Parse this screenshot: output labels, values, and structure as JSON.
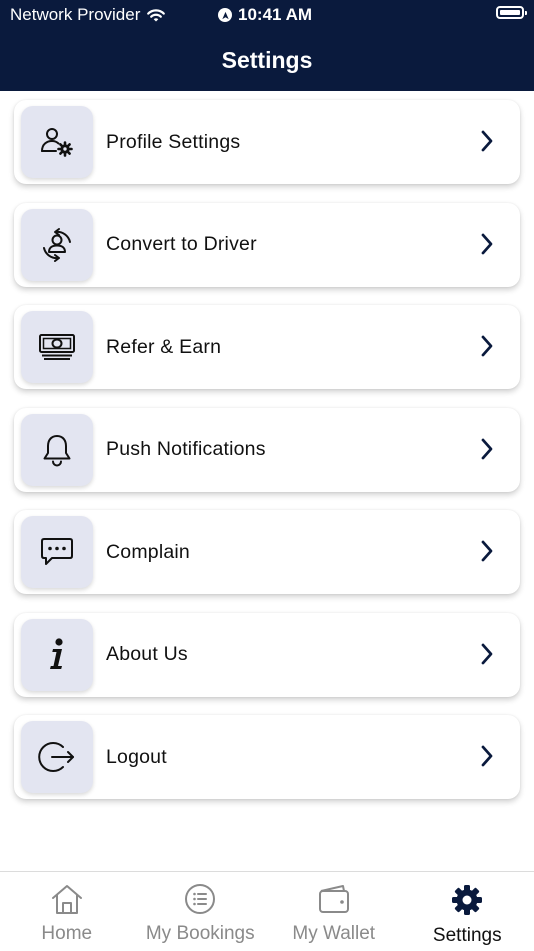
{
  "status_bar": {
    "carrier": "Network Provider",
    "time": "10:41 AM"
  },
  "header": {
    "title": "Settings"
  },
  "menu": {
    "items": [
      {
        "label": "Profile Settings",
        "icon": "user-gear-icon"
      },
      {
        "label": "Convert to Driver",
        "icon": "driver-swap-icon"
      },
      {
        "label": "Refer & Earn",
        "icon": "money-icon"
      },
      {
        "label": "Push Notifications",
        "icon": "bell-icon"
      },
      {
        "label": "Complain",
        "icon": "chat-bubble-icon"
      },
      {
        "label": "About Us",
        "icon": "info-icon"
      },
      {
        "label": "Logout",
        "icon": "logout-icon"
      }
    ]
  },
  "tabbar": {
    "tabs": [
      {
        "label": "Home",
        "icon": "home-icon"
      },
      {
        "label": "My Bookings",
        "icon": "list-icon"
      },
      {
        "label": "My Wallet",
        "icon": "wallet-icon"
      },
      {
        "label": "Settings",
        "icon": "gear-icon"
      }
    ],
    "active_index": 3
  },
  "colors": {
    "header_bg": "#0a1a3d",
    "icon_box_bg": "#e3e5f1",
    "chevron": "#0a1a3d",
    "tab_inactive": "#8a8a8a"
  }
}
